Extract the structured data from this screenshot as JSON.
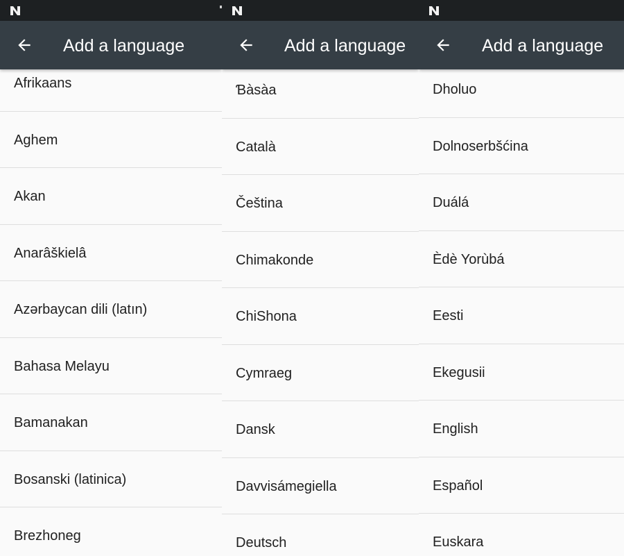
{
  "panels": [
    {
      "title": "Add a language",
      "languages": [
        "Afrikaans",
        "Aghem",
        "Akan",
        "Anarâškielâ",
        "Azərbaycan dili (latın)",
        "Bahasa Melayu",
        "Bamanakan",
        "Bosanski (latinica)",
        "Brezhoneg"
      ]
    },
    {
      "title": "Add a language",
      "languages": [
        "Ɓàsàa",
        "Català",
        "Čeština",
        "Chimakonde",
        "ChiShona",
        "Cymraeg",
        "Dansk",
        "Davvisámegiella",
        "Deutsch"
      ]
    },
    {
      "title": "Add a language",
      "languages": [
        "Dholuo",
        "Dolnoserbšćina",
        "Duálá",
        "Èdè Yorùbá",
        "Eesti",
        "Ekegusii",
        "English",
        "Español",
        "Euskara"
      ]
    }
  ],
  "icons": {
    "status_logo": "android-nougat-n-icon",
    "back": "arrow-back-icon"
  },
  "colors": {
    "status_bar": "#1d2022",
    "toolbar": "#353e45",
    "background": "#fafafa",
    "divider": "#dedede",
    "text": "#212121"
  }
}
